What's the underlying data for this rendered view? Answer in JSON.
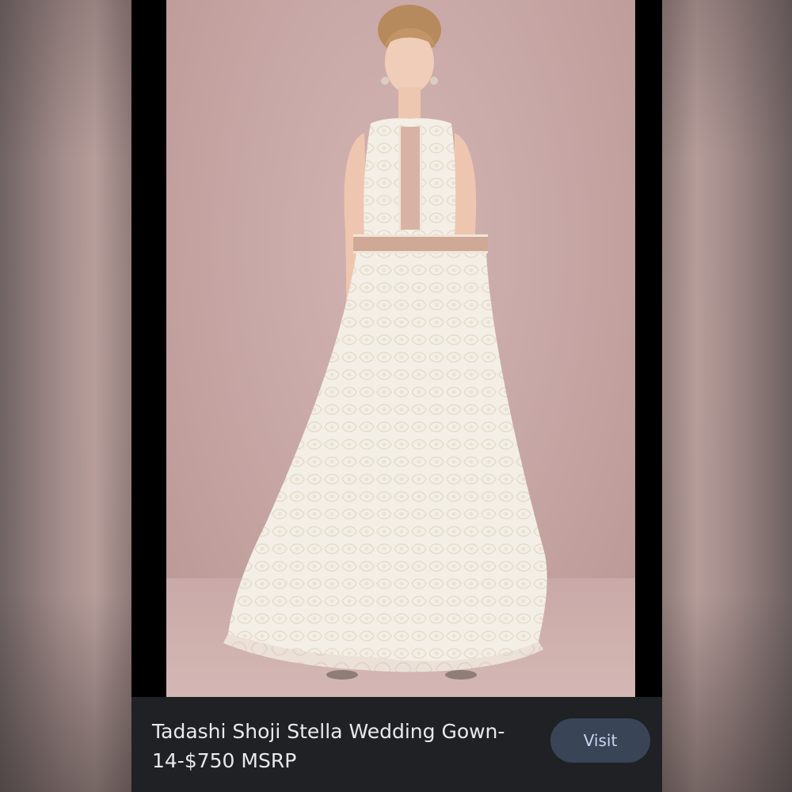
{
  "caption": {
    "title": "Tadashi Shoji Stella Wedding Gown-14-$750 MSRP"
  },
  "actions": {
    "visit_label": "Visit"
  },
  "image": {
    "subject": "woman-in-white-lace-gown",
    "background_color": "#c8a8a6"
  },
  "colors": {
    "caption_background": "#202124",
    "button_background": "#394457",
    "button_text": "#c8d7f0",
    "caption_text": "#e8eaed"
  }
}
